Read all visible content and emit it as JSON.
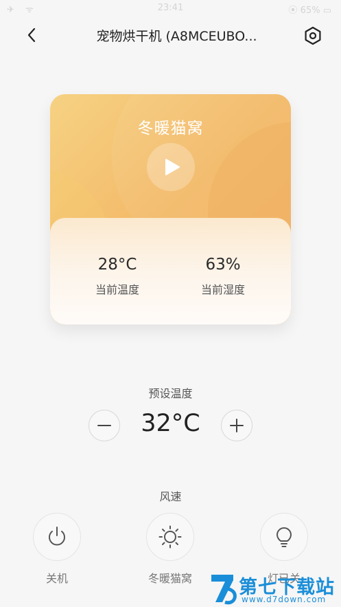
{
  "status_bar": {
    "time": "23:41",
    "left_icons": "✈ ᯤ",
    "battery": "⦿ 65% ▭"
  },
  "header": {
    "title": "宠物烘干机 (A8MCEUBO..."
  },
  "mode_card": {
    "mode_name": "冬暖猫窝",
    "current_temperature": {
      "value": "28°C",
      "label": "当前温度"
    },
    "current_humidity": {
      "value": "63%",
      "label": "当前湿度"
    }
  },
  "preset": {
    "title": "预设温度",
    "value": "32°C"
  },
  "wind": {
    "title": "风速"
  },
  "controls": [
    {
      "label": "关机",
      "icon": "power-icon"
    },
    {
      "label": "冬暖猫窝",
      "icon": "sun-icon"
    },
    {
      "label": "灯已关",
      "icon": "bulb-icon"
    }
  ],
  "watermark": {
    "title": "第七下载站",
    "url": "www.d7down.com"
  },
  "colors": {
    "card_gradient_start": "#f6d283",
    "card_gradient_end": "#f1b060",
    "watermark": "#1a8ed8"
  }
}
